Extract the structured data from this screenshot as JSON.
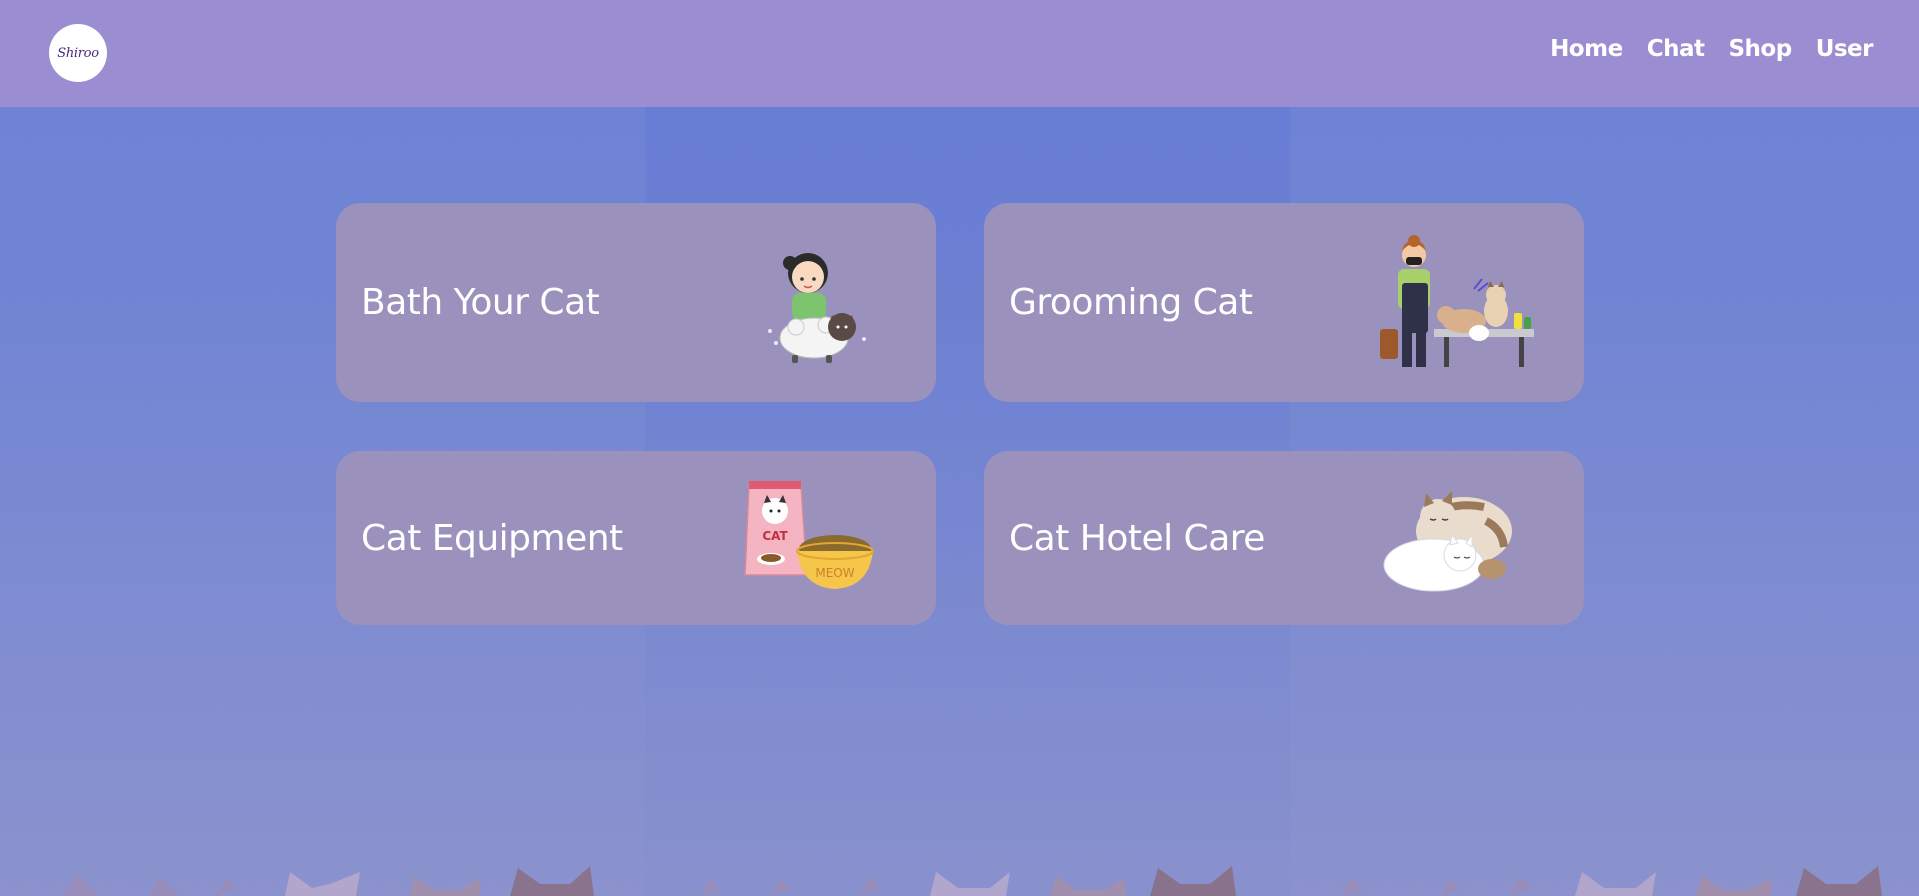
{
  "header": {
    "logo_text": "Shiroo"
  },
  "nav": {
    "items": [
      {
        "label": "Home"
      },
      {
        "label": "Chat"
      },
      {
        "label": "Shop"
      },
      {
        "label": "User"
      }
    ]
  },
  "services": [
    {
      "title": "Bath Your Cat",
      "illustration": "girl-bathing-cat"
    },
    {
      "title": "Grooming Cat",
      "illustration": "groomer-with-cats"
    },
    {
      "title": "Cat Equipment",
      "illustration": "cat-food-bag-and-bowl",
      "bag_label": "CAT",
      "bowl_label": "MEOW"
    },
    {
      "title": "Cat Hotel Care",
      "illustration": "sleeping-cats"
    }
  ],
  "colors": {
    "header": "#9b8dd2",
    "card": "#9a91bc",
    "background": "#6a80d6"
  }
}
